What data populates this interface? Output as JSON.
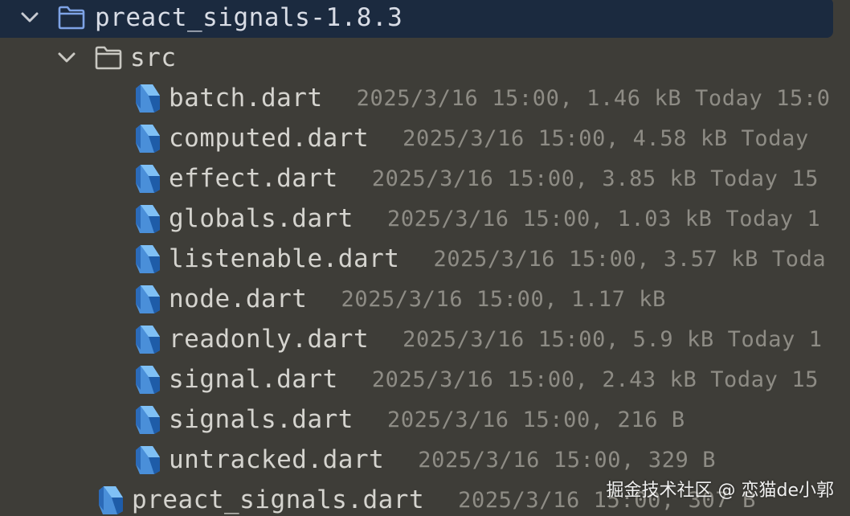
{
  "root": {
    "name": "preact_signals-1.8.3",
    "icon": "folder-icon",
    "expanded": true
  },
  "src_folder": {
    "name": "src",
    "icon": "folder-icon",
    "expanded": true
  },
  "files": [
    {
      "name": "batch.dart",
      "meta": "2025/3/16 15:00, 1.46 kB Today 15:0",
      "icon": "dart-file-icon"
    },
    {
      "name": "computed.dart",
      "meta": "2025/3/16 15:00, 4.58 kB Today",
      "icon": "dart-file-icon"
    },
    {
      "name": "effect.dart",
      "meta": "2025/3/16 15:00, 3.85 kB Today 15",
      "icon": "dart-file-icon"
    },
    {
      "name": "globals.dart",
      "meta": "2025/3/16 15:00, 1.03 kB Today 1",
      "icon": "dart-file-icon"
    },
    {
      "name": "listenable.dart",
      "meta": "2025/3/16 15:00, 3.57 kB Toda",
      "icon": "dart-file-icon"
    },
    {
      "name": "node.dart",
      "meta": "2025/3/16 15:00, 1.17 kB",
      "icon": "dart-file-icon"
    },
    {
      "name": "readonly.dart",
      "meta": "2025/3/16 15:00, 5.9 kB Today 1",
      "icon": "dart-file-icon"
    },
    {
      "name": "signal.dart",
      "meta": "2025/3/16 15:00, 2.43 kB Today 15",
      "icon": "dart-file-icon"
    },
    {
      "name": "signals.dart",
      "meta": "2025/3/16 15:00, 216 B",
      "icon": "dart-file-icon"
    },
    {
      "name": "untracked.dart",
      "meta": "2025/3/16 15:00, 329 B",
      "icon": "dart-file-icon"
    }
  ],
  "root_file": {
    "name": "preact_signals.dart",
    "meta": "2025/3/16 15:00, 307 B",
    "icon": "dart-file-icon"
  },
  "watermark": "掘金技术社区 @ 恋猫de小郭",
  "colors": {
    "background": "#3e3d38",
    "selected_row": "#1b2a3f",
    "folder_selected": "#7ea3e6",
    "folder": "#c9c8c2",
    "dart_icon": "#4a8fd9",
    "name_text": "#d5d4cf",
    "meta_text": "#8e8c85"
  }
}
